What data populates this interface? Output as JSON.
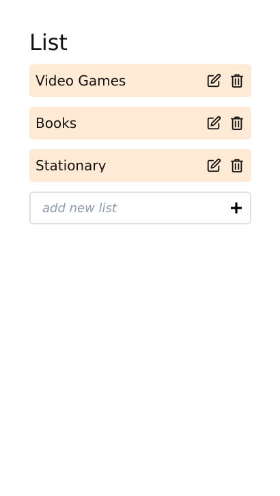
{
  "page": {
    "title": "List"
  },
  "lists": [
    {
      "label": "Video Games",
      "edit_icon": "edit-icon",
      "delete_icon": "trash-icon"
    },
    {
      "label": "Books",
      "edit_icon": "edit-icon",
      "delete_icon": "trash-icon"
    },
    {
      "label": "Stationary",
      "edit_icon": "edit-icon",
      "delete_icon": "trash-icon"
    }
  ],
  "new_list": {
    "value": "",
    "placeholder": "add new list",
    "add_icon": "plus-icon"
  },
  "colors": {
    "item_background": "#ffebd5",
    "input_border": "#dfe1e4",
    "placeholder": "#8e9bb0",
    "text": "#111111"
  }
}
